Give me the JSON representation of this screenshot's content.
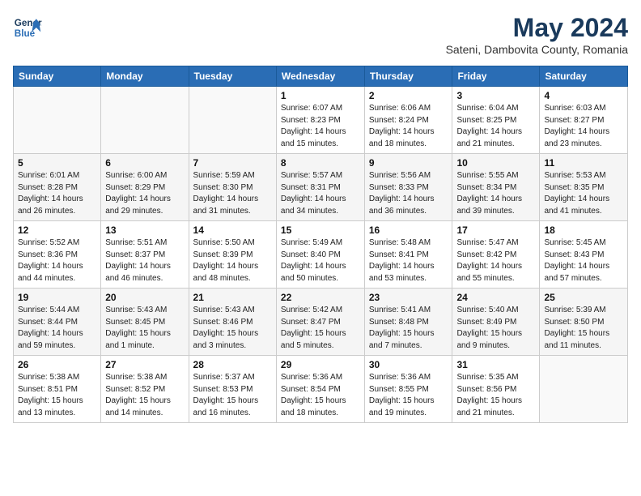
{
  "header": {
    "logo_line1": "General",
    "logo_line2": "Blue",
    "title": "May 2024",
    "subtitle": "Sateni, Dambovita County, Romania"
  },
  "days_of_week": [
    "Sunday",
    "Monday",
    "Tuesday",
    "Wednesday",
    "Thursday",
    "Friday",
    "Saturday"
  ],
  "weeks": [
    [
      {
        "day": "",
        "info": ""
      },
      {
        "day": "",
        "info": ""
      },
      {
        "day": "",
        "info": ""
      },
      {
        "day": "1",
        "info": "Sunrise: 6:07 AM\nSunset: 8:23 PM\nDaylight: 14 hours\nand 15 minutes."
      },
      {
        "day": "2",
        "info": "Sunrise: 6:06 AM\nSunset: 8:24 PM\nDaylight: 14 hours\nand 18 minutes."
      },
      {
        "day": "3",
        "info": "Sunrise: 6:04 AM\nSunset: 8:25 PM\nDaylight: 14 hours\nand 21 minutes."
      },
      {
        "day": "4",
        "info": "Sunrise: 6:03 AM\nSunset: 8:27 PM\nDaylight: 14 hours\nand 23 minutes."
      }
    ],
    [
      {
        "day": "5",
        "info": "Sunrise: 6:01 AM\nSunset: 8:28 PM\nDaylight: 14 hours\nand 26 minutes."
      },
      {
        "day": "6",
        "info": "Sunrise: 6:00 AM\nSunset: 8:29 PM\nDaylight: 14 hours\nand 29 minutes."
      },
      {
        "day": "7",
        "info": "Sunrise: 5:59 AM\nSunset: 8:30 PM\nDaylight: 14 hours\nand 31 minutes."
      },
      {
        "day": "8",
        "info": "Sunrise: 5:57 AM\nSunset: 8:31 PM\nDaylight: 14 hours\nand 34 minutes."
      },
      {
        "day": "9",
        "info": "Sunrise: 5:56 AM\nSunset: 8:33 PM\nDaylight: 14 hours\nand 36 minutes."
      },
      {
        "day": "10",
        "info": "Sunrise: 5:55 AM\nSunset: 8:34 PM\nDaylight: 14 hours\nand 39 minutes."
      },
      {
        "day": "11",
        "info": "Sunrise: 5:53 AM\nSunset: 8:35 PM\nDaylight: 14 hours\nand 41 minutes."
      }
    ],
    [
      {
        "day": "12",
        "info": "Sunrise: 5:52 AM\nSunset: 8:36 PM\nDaylight: 14 hours\nand 44 minutes."
      },
      {
        "day": "13",
        "info": "Sunrise: 5:51 AM\nSunset: 8:37 PM\nDaylight: 14 hours\nand 46 minutes."
      },
      {
        "day": "14",
        "info": "Sunrise: 5:50 AM\nSunset: 8:39 PM\nDaylight: 14 hours\nand 48 minutes."
      },
      {
        "day": "15",
        "info": "Sunrise: 5:49 AM\nSunset: 8:40 PM\nDaylight: 14 hours\nand 50 minutes."
      },
      {
        "day": "16",
        "info": "Sunrise: 5:48 AM\nSunset: 8:41 PM\nDaylight: 14 hours\nand 53 minutes."
      },
      {
        "day": "17",
        "info": "Sunrise: 5:47 AM\nSunset: 8:42 PM\nDaylight: 14 hours\nand 55 minutes."
      },
      {
        "day": "18",
        "info": "Sunrise: 5:45 AM\nSunset: 8:43 PM\nDaylight: 14 hours\nand 57 minutes."
      }
    ],
    [
      {
        "day": "19",
        "info": "Sunrise: 5:44 AM\nSunset: 8:44 PM\nDaylight: 14 hours\nand 59 minutes."
      },
      {
        "day": "20",
        "info": "Sunrise: 5:43 AM\nSunset: 8:45 PM\nDaylight: 15 hours\nand 1 minute."
      },
      {
        "day": "21",
        "info": "Sunrise: 5:43 AM\nSunset: 8:46 PM\nDaylight: 15 hours\nand 3 minutes."
      },
      {
        "day": "22",
        "info": "Sunrise: 5:42 AM\nSunset: 8:47 PM\nDaylight: 15 hours\nand 5 minutes."
      },
      {
        "day": "23",
        "info": "Sunrise: 5:41 AM\nSunset: 8:48 PM\nDaylight: 15 hours\nand 7 minutes."
      },
      {
        "day": "24",
        "info": "Sunrise: 5:40 AM\nSunset: 8:49 PM\nDaylight: 15 hours\nand 9 minutes."
      },
      {
        "day": "25",
        "info": "Sunrise: 5:39 AM\nSunset: 8:50 PM\nDaylight: 15 hours\nand 11 minutes."
      }
    ],
    [
      {
        "day": "26",
        "info": "Sunrise: 5:38 AM\nSunset: 8:51 PM\nDaylight: 15 hours\nand 13 minutes."
      },
      {
        "day": "27",
        "info": "Sunrise: 5:38 AM\nSunset: 8:52 PM\nDaylight: 15 hours\nand 14 minutes."
      },
      {
        "day": "28",
        "info": "Sunrise: 5:37 AM\nSunset: 8:53 PM\nDaylight: 15 hours\nand 16 minutes."
      },
      {
        "day": "29",
        "info": "Sunrise: 5:36 AM\nSunset: 8:54 PM\nDaylight: 15 hours\nand 18 minutes."
      },
      {
        "day": "30",
        "info": "Sunrise: 5:36 AM\nSunset: 8:55 PM\nDaylight: 15 hours\nand 19 minutes."
      },
      {
        "day": "31",
        "info": "Sunrise: 5:35 AM\nSunset: 8:56 PM\nDaylight: 15 hours\nand 21 minutes."
      },
      {
        "day": "",
        "info": ""
      }
    ]
  ]
}
